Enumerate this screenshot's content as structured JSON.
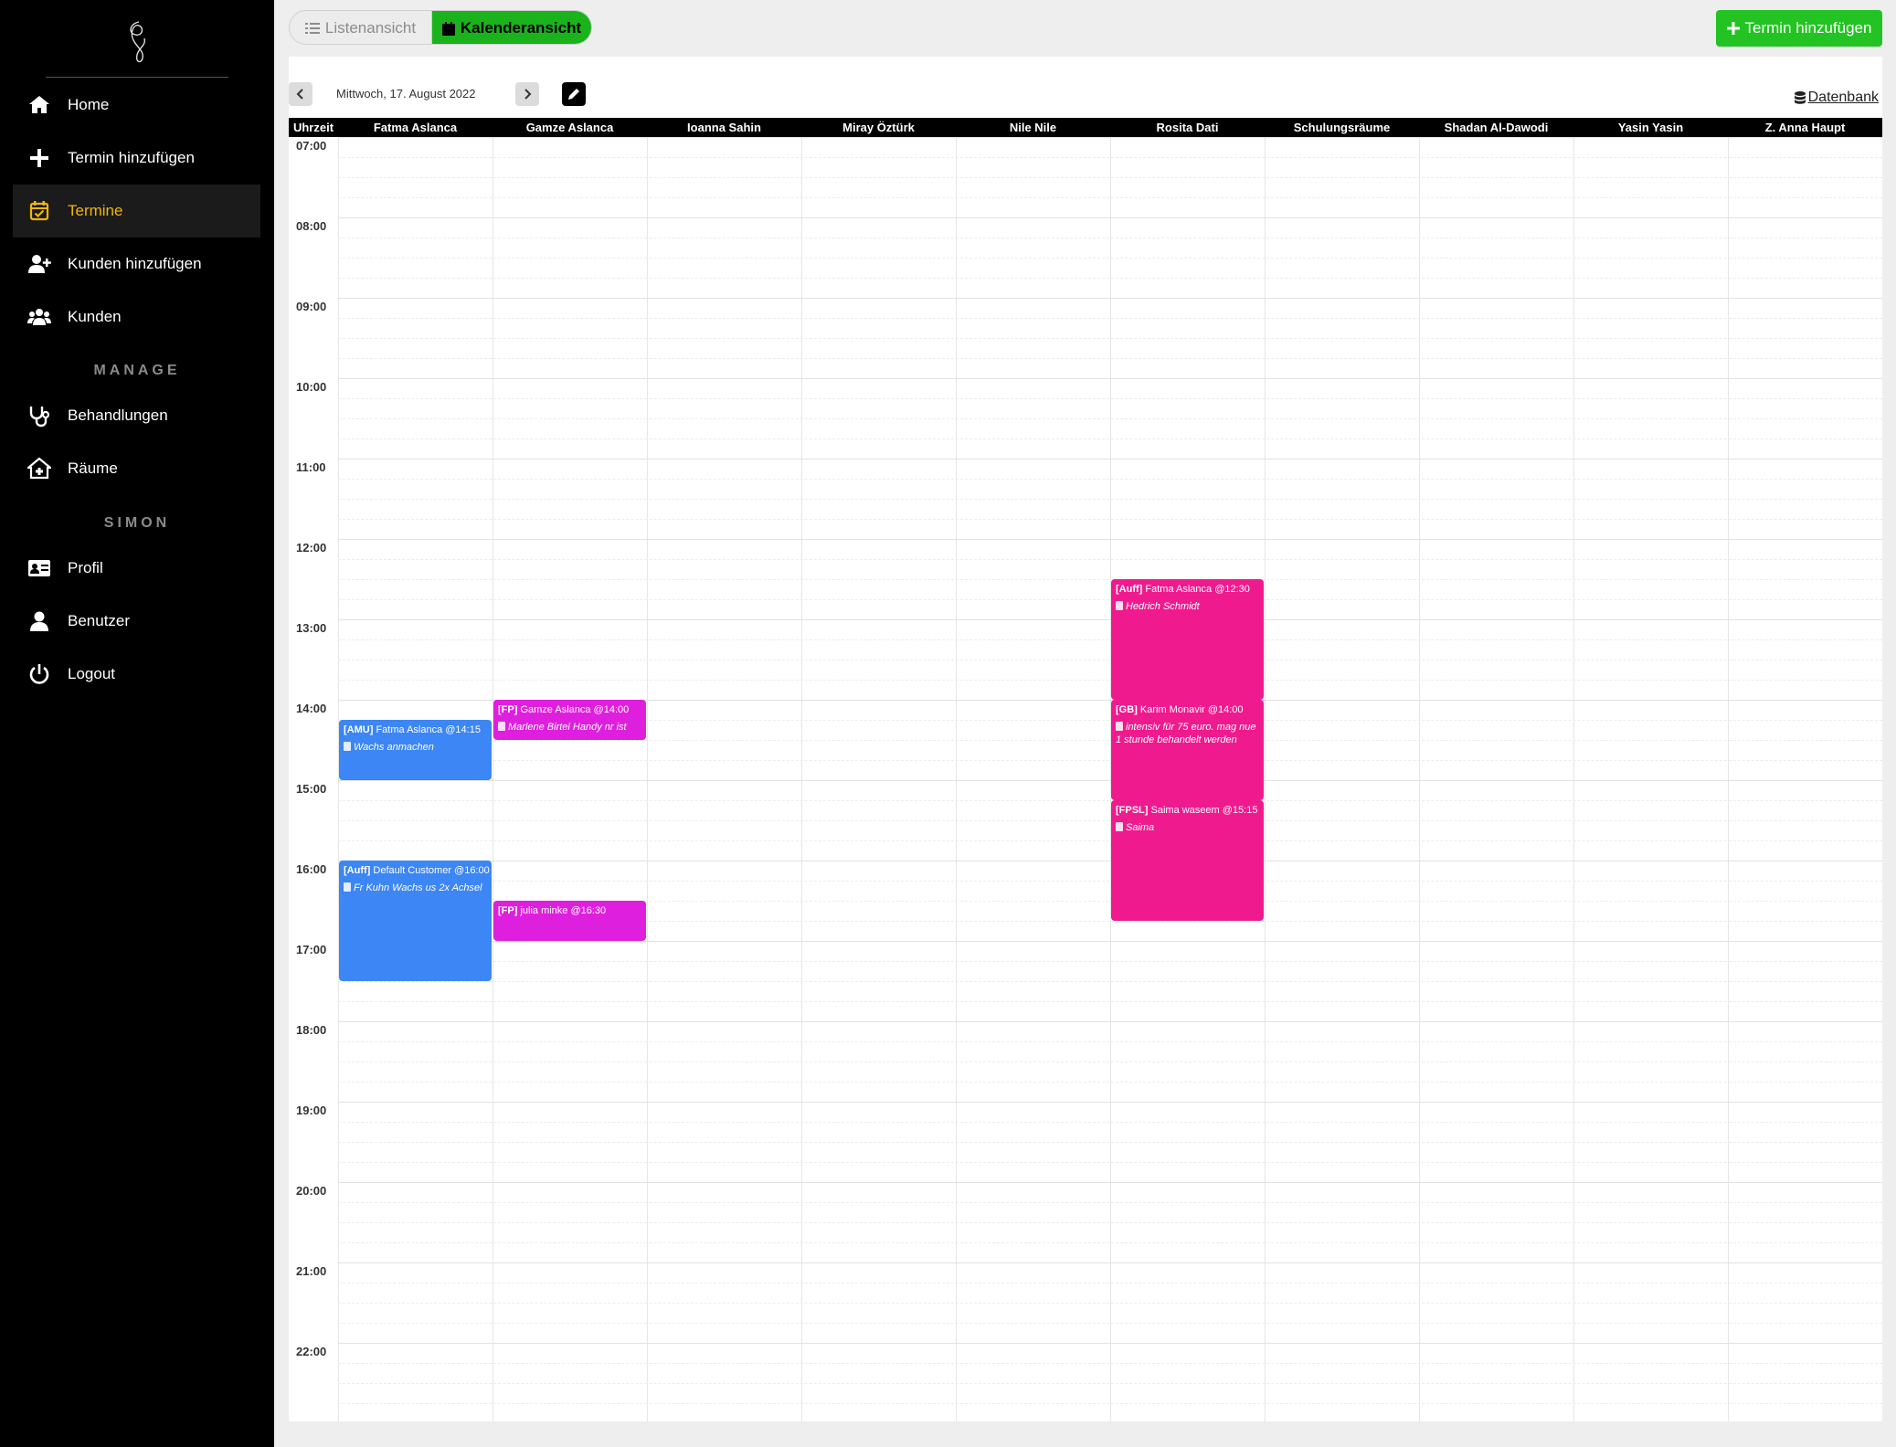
{
  "sidebar": {
    "nav": [
      {
        "label": "Home",
        "icon": "home-icon"
      },
      {
        "label": "Termin hinzufügen",
        "icon": "plus-icon"
      },
      {
        "label": "Termine",
        "icon": "calendar-check-icon",
        "active": true
      },
      {
        "label": "Kunden hinzufügen",
        "icon": "user-plus-icon"
      },
      {
        "label": "Kunden",
        "icon": "users-icon"
      }
    ],
    "manage_heading": "MANAGE",
    "manage": [
      {
        "label": "Behandlungen",
        "icon": "stethoscope-icon"
      },
      {
        "label": "Räume",
        "icon": "house-medical-icon"
      }
    ],
    "user_heading": "SIMON",
    "user": [
      {
        "label": "Profil",
        "icon": "id-card-icon"
      },
      {
        "label": "Benutzer",
        "icon": "user-icon"
      },
      {
        "label": "Logout",
        "icon": "power-icon"
      }
    ]
  },
  "topbar": {
    "list_view": "Listenansicht",
    "calendar_view": "Kalenderansicht",
    "add_appointment": "Termin hinzufügen"
  },
  "calendar": {
    "date": "Mittwoch, 17. August 2022",
    "database_link": "Datenbank",
    "time_header": "Uhrzeit",
    "columns": [
      "Fatma Aslanca",
      "Gamze Aslanca",
      "Ioanna Sahin",
      "Miray Öztürk",
      "Nile Nile",
      "Rosita Dati",
      "Schulungsräume",
      "Shadan Al-Dawodi",
      "Yasin Yasin",
      "Z. Anna Haupt"
    ],
    "hours": [
      "07:00",
      "08:00",
      "09:00",
      "10:00",
      "11:00",
      "12:00",
      "13:00",
      "14:00",
      "15:00",
      "16:00",
      "17:00",
      "18:00",
      "19:00",
      "20:00",
      "21:00",
      "22:00"
    ],
    "appointments": [
      {
        "column": 0,
        "start": "14:15",
        "end": "15:00",
        "tag": "[AMU]",
        "title": "Fatma Aslanca @14:15",
        "note": "Wachs anmachen",
        "color": "#3c86f5"
      },
      {
        "column": 0,
        "start": "16:00",
        "end": "17:30",
        "tag": "[Auff]",
        "title": "Default Customer @16:00",
        "note": "Fr Kuhn Wachs us 2x Achsel",
        "color": "#3c86f5"
      },
      {
        "column": 1,
        "start": "14:00",
        "end": "14:30",
        "tag": "[FP]",
        "title": "Gamze Aslanca @14:00",
        "note": "Marlene Birtel Handy nr ist",
        "color": "#df1fde"
      },
      {
        "column": 1,
        "start": "16:30",
        "end": "17:00",
        "tag": "[FP]",
        "title": "julia minke @16:30",
        "note": "",
        "color": "#df1fde"
      },
      {
        "column": 5,
        "start": "12:30",
        "end": "14:00",
        "tag": "[Auff]",
        "title": "Fatma Aslanca @12:30",
        "note": "Hedrich Schmidt",
        "color": "#ef1a8e"
      },
      {
        "column": 5,
        "start": "14:00",
        "end": "15:15",
        "tag": "[GB]",
        "title": "Karim Monavir @14:00",
        "note": "intensiv für 75 euro. mag nue 1 stunde behandelt werden",
        "color": "#ef1a8e"
      },
      {
        "column": 5,
        "start": "15:15",
        "end": "16:45",
        "tag": "[FPSL]",
        "title": "Saima waseem @15:15",
        "note": "Saima",
        "color": "#ef1a8e"
      }
    ]
  }
}
